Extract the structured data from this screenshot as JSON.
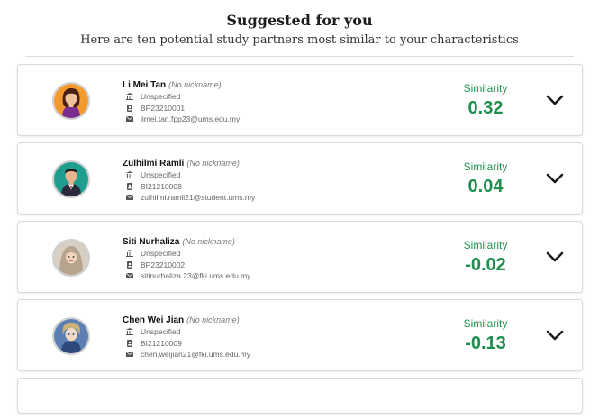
{
  "header": {
    "title": "Suggested for you",
    "subtitle": "Here are ten potential study partners most similar to your characteristics"
  },
  "similarity_label": "Similarity",
  "accent_color": "#1f8f4e",
  "partners": [
    {
      "name": "Li Mei Tan",
      "nickname": "(No nickname)",
      "faculty": "Unspecified",
      "matric": "BP23210001",
      "email": "limei.tan.fpp23@ums.edu.my",
      "similarity": "0.32",
      "avatar": "woman-orange-avatar-icon"
    },
    {
      "name": "Zulhilmi Ramli",
      "nickname": "(No nickname)",
      "faculty": "Unspecified",
      "matric": "BI21210008",
      "email": "zulhilmi.ramli21@student.ums.my",
      "similarity": "0.04",
      "avatar": "man-teal-avatar-icon"
    },
    {
      "name": "Siti Nurhaliza",
      "nickname": "(No nickname)",
      "faculty": "Unspecified",
      "matric": "BP23210002",
      "email": "sitinurhaliza.23@fki.ums.edu.my",
      "similarity": "-0.02",
      "avatar": "hijab-woman-avatar-icon"
    },
    {
      "name": "Chen Wei Jian",
      "nickname": "(No nickname)",
      "faculty": "Unspecified",
      "matric": "BI21210009",
      "email": "chen.weijian21@fki.ums.edu.my",
      "similarity": "-0.13",
      "avatar": "anime-boy-avatar-icon"
    }
  ]
}
